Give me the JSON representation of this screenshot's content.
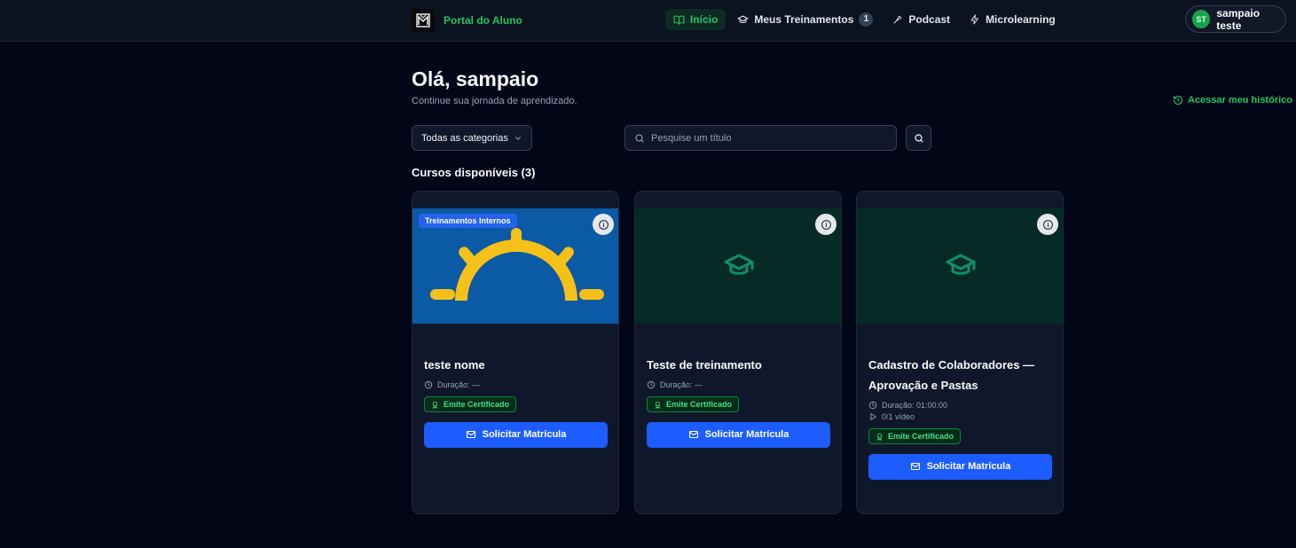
{
  "navbar": {
    "brand": "Portal do Aluno",
    "items": [
      {
        "label": "Início",
        "icon": "book-open-icon",
        "active": true
      },
      {
        "label": "Meus Treinamentos",
        "icon": "graduation-cap-icon",
        "badge": "1"
      },
      {
        "label": "Podcast",
        "icon": "microphone-icon"
      },
      {
        "label": "Microlearning",
        "icon": "lightning-icon"
      }
    ],
    "user": {
      "initials": "ST",
      "name": "sampaio teste"
    }
  },
  "header": {
    "greeting": "Olá, sampaio",
    "subtitle": "Continue sua jornada de aprendizado.",
    "history_link": "Acessar meu histórico"
  },
  "filters": {
    "category_selected": "Todas as categorias",
    "search_placeholder": "Pesquise um título"
  },
  "section_title": "Cursos disponíveis (3)",
  "courses": [
    {
      "title": "teste nome",
      "category_badge": "Treinamentos Internos",
      "duration": "Duração: —",
      "certificate": "Emite Certificado",
      "action": "Solicitar Matrícula"
    },
    {
      "title": "Teste de treinamento",
      "duration": "Duração: —",
      "certificate": "Emite Certificado",
      "action": "Solicitar Matrícula"
    },
    {
      "title": "Cadastro de Colaboradores — Aprovação e Pastas",
      "duration": "Duração: 01:00:00",
      "videos": "0/1 vídeo",
      "certificate": "Emite Certificado",
      "action": "Solicitar Matrícula"
    }
  ],
  "colors": {
    "accent_green": "#22c55e",
    "primary_blue": "#1d5cff",
    "background": "#020617"
  }
}
